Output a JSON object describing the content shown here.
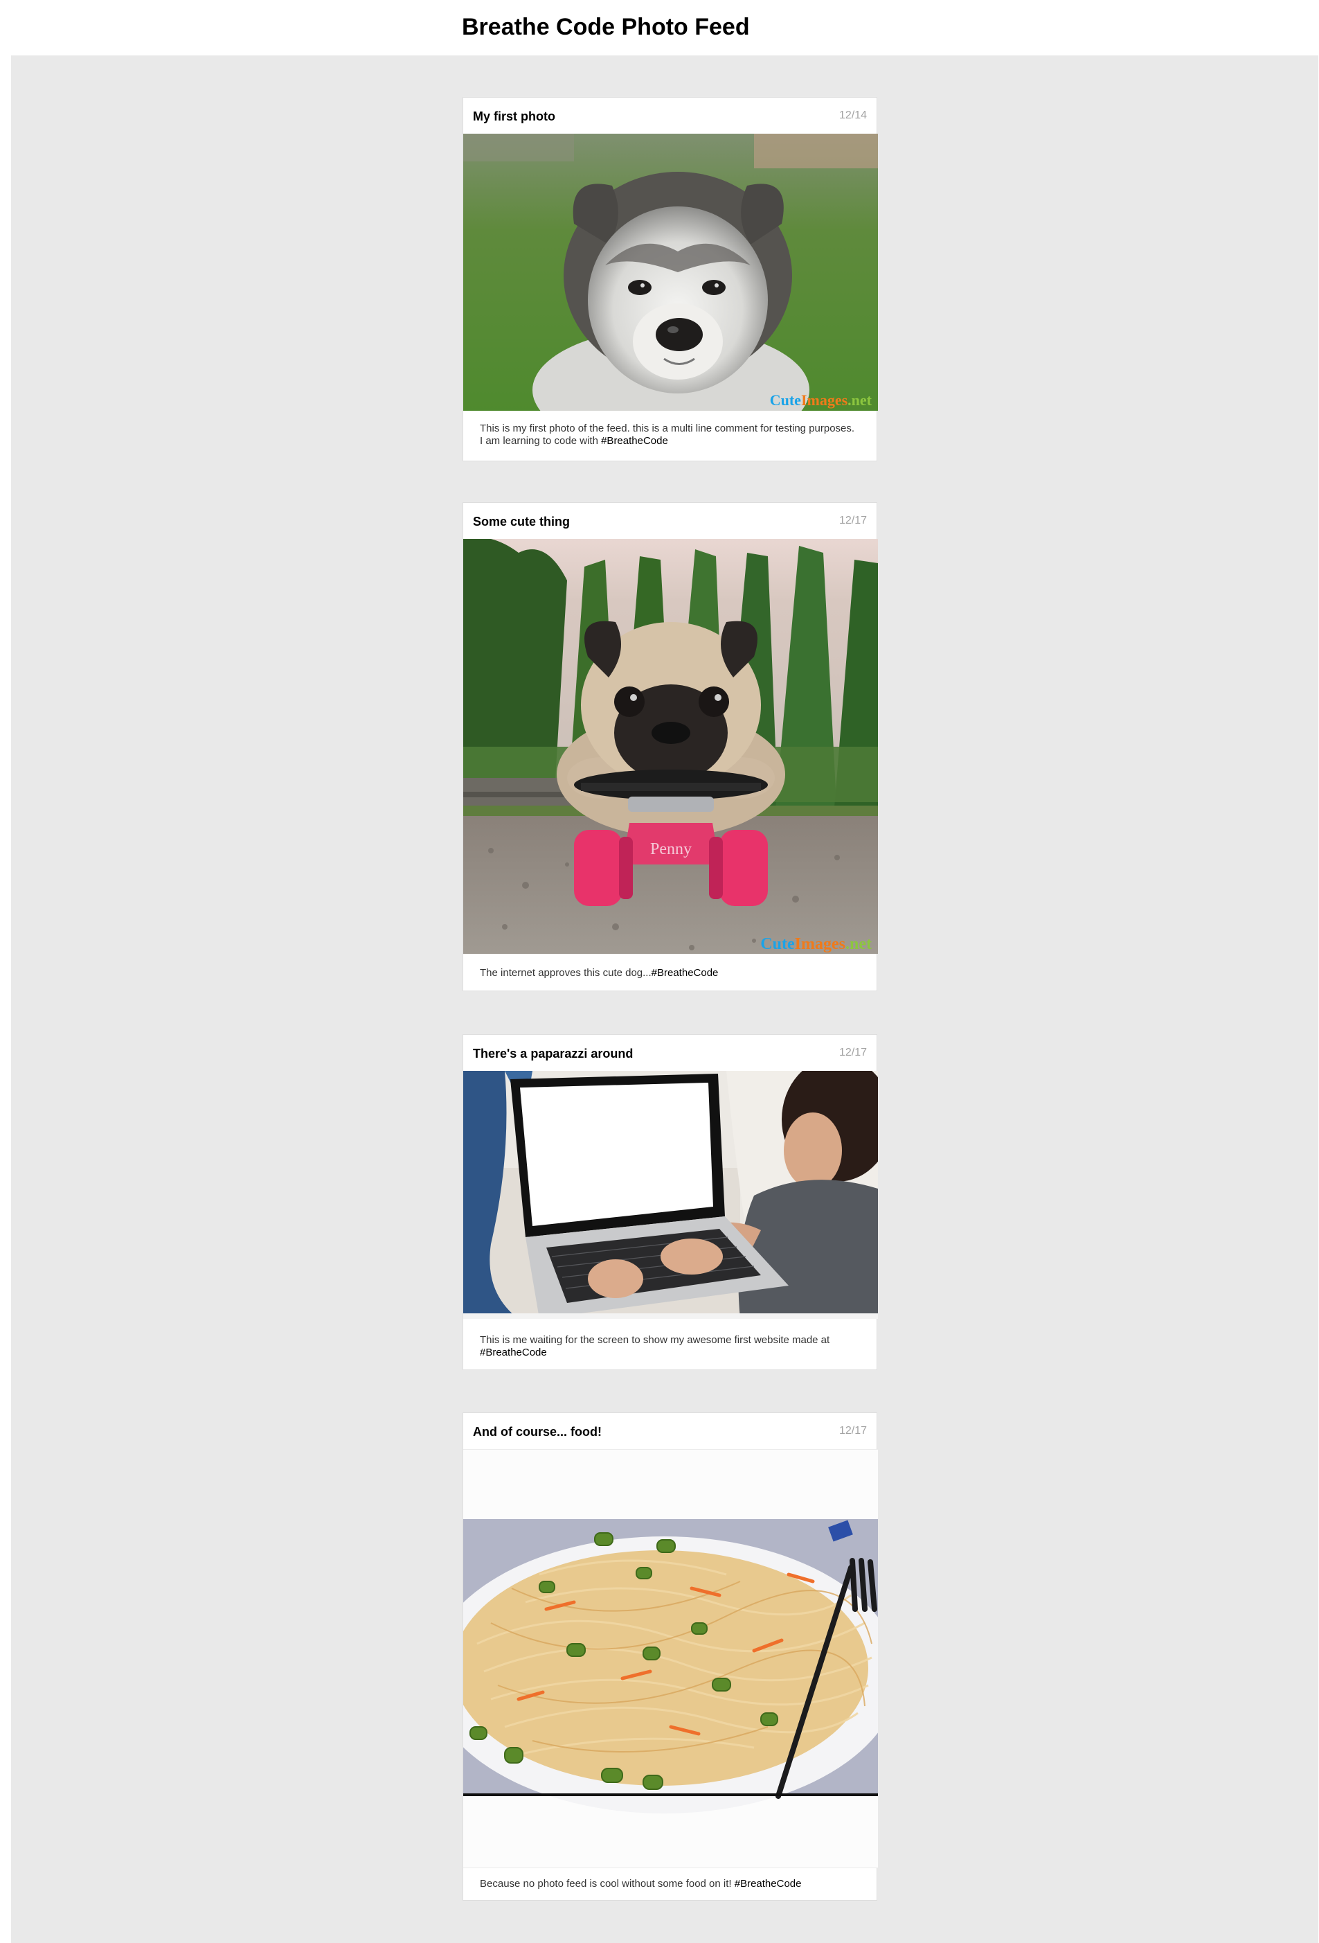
{
  "header": {
    "title": "Breathe Code Photo Feed"
  },
  "posts": [
    {
      "title": "My first photo",
      "date": "12/14",
      "caption": "This is my first photo of the feed. this is a multi line comment for testing purposes. I am learning to code with ",
      "hashtag": "#BreatheCode",
      "photo": "husky-puppy-photo",
      "watermark": "CuteImages.net"
    },
    {
      "title": "Some cute thing",
      "date": "12/17",
      "caption": "The internet approves this cute dog...",
      "hashtag": "#BreatheCode",
      "photo": "pug-on-skateboard-photo",
      "watermark": "CuteImages.net",
      "board_text": "Penny"
    },
    {
      "title": "There's a paparazzi around",
      "date": "12/17",
      "caption": "This is me waiting for the screen to show my awesome first website made at ",
      "hashtag": "#BreatheCode",
      "photo": "woman-with-laptop-photo"
    },
    {
      "title": "And of course... food!",
      "date": "12/17",
      "caption": "Because no photo feed is cool without some food on it! ",
      "hashtag": "#BreatheCode",
      "photo": "noodles-photo"
    }
  ],
  "colors": {
    "feed_background": "#e9e9e9",
    "date_gray": "#a3a3a3",
    "watermark_blue": "#1aa3e8",
    "watermark_orange": "#f07a1a",
    "watermark_green": "#8cc63f"
  }
}
